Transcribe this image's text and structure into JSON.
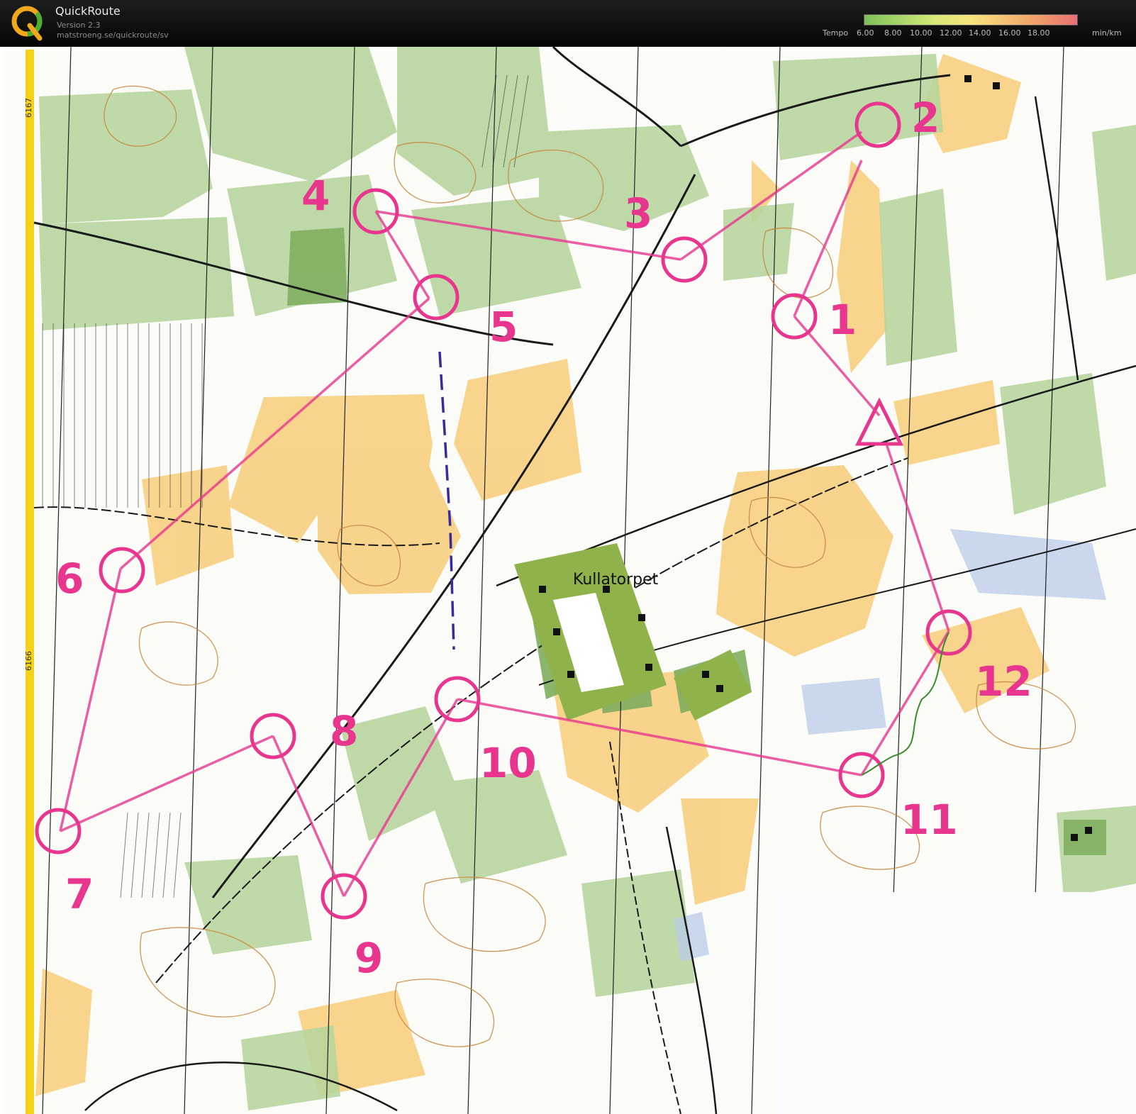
{
  "app": {
    "title": "QuickRoute",
    "version": "Version 2.3",
    "url": "matstroeng.se/quickroute/sv"
  },
  "legend": {
    "label": "Tempo",
    "ticks": [
      "6.00",
      "8.00",
      "10.00",
      "12.00",
      "14.00",
      "16.00",
      "18.00"
    ],
    "unit": "min/km",
    "gradient_colors": [
      "#7fbf5a",
      "#a9d56c",
      "#d8e878",
      "#f6e37f",
      "#f5c073",
      "#ef9a6a",
      "#e96f76"
    ]
  },
  "map": {
    "grid_labels": [
      "6167",
      "6166"
    ],
    "place_name": "Kullatorpet",
    "control_numbers": [
      "1",
      "2",
      "3",
      "4",
      "5",
      "6",
      "7",
      "8",
      "9",
      "10",
      "11",
      "12"
    ],
    "colors": {
      "open_land": "#f8cf80",
      "forest_green": "#b4d39a",
      "dark_green": "#7fae5f",
      "course_magenta": "#e8368f",
      "route_purple": "#3a2a9a",
      "contour": "#c8843a",
      "margin_yellow": "#f5d21a"
    }
  }
}
